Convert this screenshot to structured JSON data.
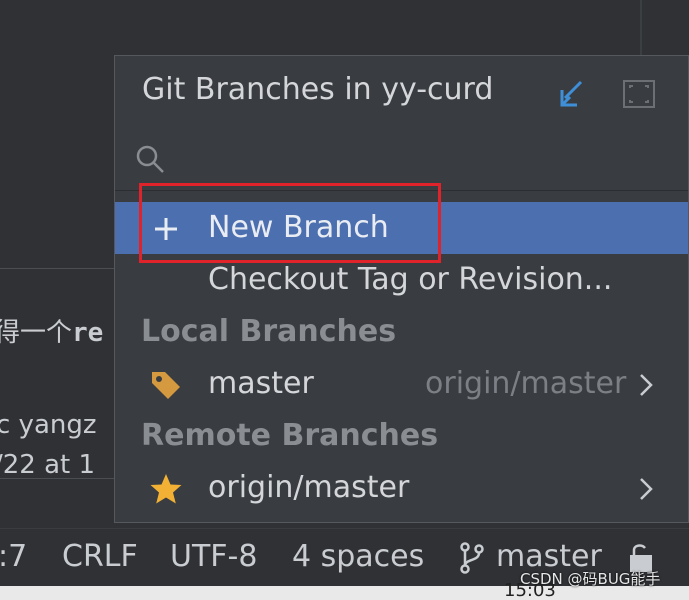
{
  "background": {
    "lines": [
      {
        "prefix": "得一个",
        "mono": "re"
      },
      {
        "prefix": "c yangz",
        "mono": ""
      },
      {
        "prefix": "/22 at 1",
        "mono": ""
      }
    ]
  },
  "popup": {
    "title": "Git Branches in yy-curd",
    "search_placeholder": "",
    "actions": {
      "new_branch": "New Branch",
      "checkout": "Checkout Tag or Revision..."
    },
    "local": {
      "header": "Local Branches",
      "branches": [
        {
          "name": "master",
          "tracking": "origin/master",
          "icon": "tag-icon"
        }
      ]
    },
    "remote": {
      "header": "Remote Branches",
      "branches": [
        {
          "name": "origin/master",
          "icon": "star-icon"
        }
      ]
    }
  },
  "statusbar": {
    "position": ":7",
    "line_separator": "CRLF",
    "encoding": "UTF-8",
    "indent": "4 spaces",
    "branch": "master"
  },
  "taskbar": {
    "clock": "15:03"
  },
  "watermark": "CSDN @码BUG能手",
  "colors": {
    "selection": "#4c6fb0",
    "highlight_box": "#e0232b",
    "accent_icon": "#3f8fd8",
    "tag_icon": "#d59a3f",
    "star_icon": "#f2b134"
  }
}
